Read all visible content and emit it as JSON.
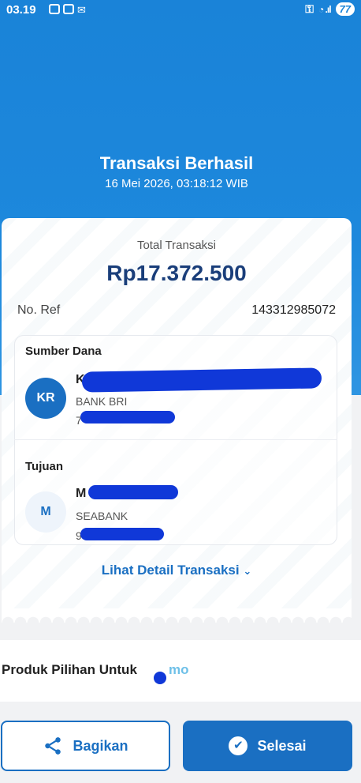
{
  "status_bar": {
    "time": "03.19",
    "battery": "77"
  },
  "header": {
    "title": "Transaksi Berhasil",
    "datetime": "16 Mei 2026, 03:18:12 WIB"
  },
  "receipt": {
    "total_label": "Total Transaksi",
    "total_amount": "Rp17.372.500",
    "ref_label": "No. Ref",
    "ref_value": "143312985072"
  },
  "source": {
    "section_label": "Sumber Dana",
    "initials": "KR",
    "name_visible": "K",
    "bank": "BANK BRI",
    "account_visible": "7"
  },
  "destination": {
    "section_label": "Tujuan",
    "initials": "M",
    "name_visible": "M",
    "bank": "SEABANK",
    "account_visible": "9"
  },
  "detail_link": {
    "label": "Lihat Detail Transaksi",
    "icon": "chevron-down-icon"
  },
  "products": {
    "title": "Produk Pilihan Untuk",
    "tail": "mo"
  },
  "actions": {
    "share_label": "Bagikan",
    "share_icon": "share-icon",
    "done_label": "Selesai",
    "done_icon": "check-circle-icon"
  },
  "colors": {
    "brand_blue": "#1a83d8",
    "accent": "#1a6fc2",
    "amount": "#1a3e7a"
  }
}
